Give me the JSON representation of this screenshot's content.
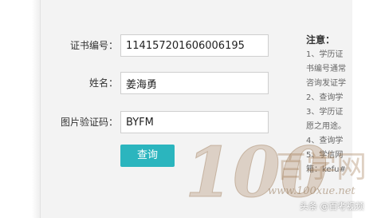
{
  "form": {
    "cert_no_label": "证书编号：",
    "cert_no_value": "114157201606006195",
    "name_label": "姓名：",
    "name_value": "姜海勇",
    "captcha_label": "图片验证码：",
    "captcha_value": "BYFM",
    "submit_label": "查询"
  },
  "notice": {
    "title": "注意：",
    "lines": [
      "1、学历证",
      "书编号通常",
      "咨询发证学",
      "2、查询学",
      "3、学历证",
      "愿之用途。",
      "4、查询学",
      "5、学信网",
      "箱：kefu#"
    ]
  },
  "watermark": {
    "brand_digits": "100",
    "brand_text": "百学网",
    "site": "www.100xue.net",
    "source": "头条 @百考视频"
  },
  "colors": {
    "button": "#2bb5be",
    "panel": "#f3f3f3"
  }
}
